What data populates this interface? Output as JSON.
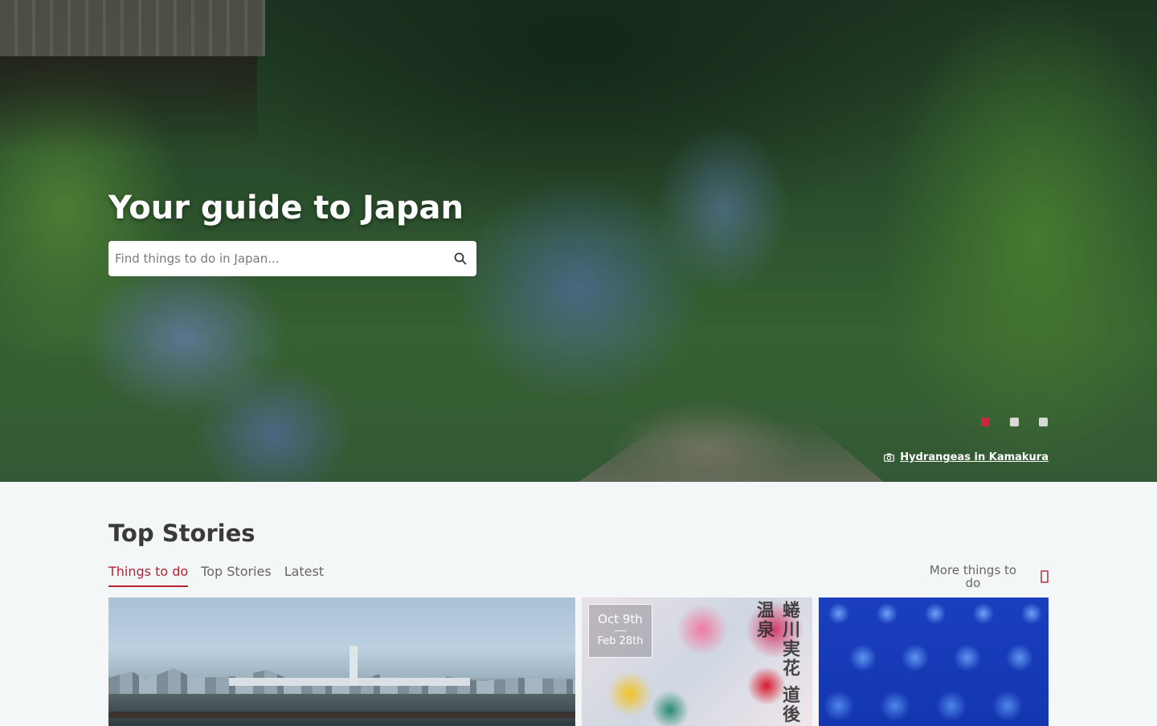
{
  "hero": {
    "title": "Your guide to Japan",
    "search_placeholder": "Find things to do in Japan...",
    "slides_count": 3,
    "active_slide": 1,
    "photo_credit": "Hydrangeas in Kamakura",
    "icons": {
      "search": "search-icon",
      "camera": "camera-icon"
    },
    "colors": {
      "active_dot": "#c8293a",
      "inactive_dot": "#d8d8d8"
    }
  },
  "top_stories": {
    "title": "Top Stories",
    "tabs": [
      {
        "label": "Things to do",
        "active": true
      },
      {
        "label": "Top Stories",
        "active": false
      },
      {
        "label": "Latest",
        "active": false
      }
    ],
    "more_label": "More things to do",
    "cards": [
      {
        "image": "Tokyo waterfront with Rainbow Bridge"
      },
      {
        "image": "Mika Ninagawa Dogo Onsen art poster",
        "date_from": "Oct 9th",
        "date_to": "Feb 28th",
        "poster_text": "蜷川実花 道後温泉"
      },
      {
        "image": "Blue sphere installation"
      }
    ],
    "colors": {
      "accent": "#b5232f"
    }
  }
}
